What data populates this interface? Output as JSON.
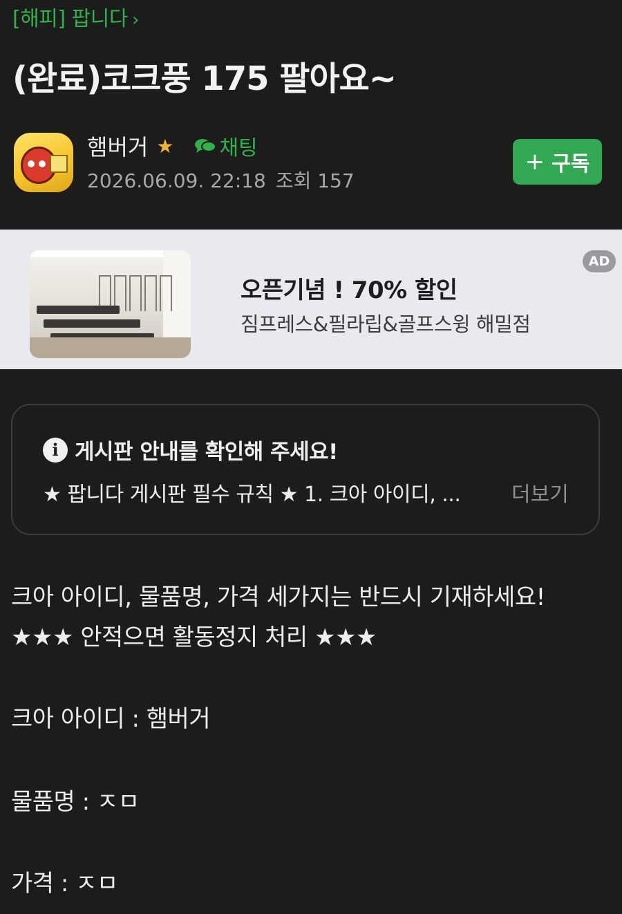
{
  "board": {
    "link_text": "[해피] 팝니다",
    "chevron": "›"
  },
  "post": {
    "title": "(완료)코크풍 175 팔아요~"
  },
  "author": {
    "nickname": "햄버거",
    "badge": "★",
    "chat_label": "채팅",
    "date": "2026.06.09. 22:18",
    "views": "조회 157"
  },
  "subscribe": {
    "icon": "+",
    "label": "구독"
  },
  "ad": {
    "title": "오픈기념 ! 70% 할인",
    "subtitle": "짐프레스&필라립&골프스윙 해밀점",
    "badge": "AD"
  },
  "notice": {
    "icon": "i",
    "heading": "게시판 안내를 확인해 주세요!",
    "preview": "★ 팝니다 게시판 필수 규칙 ★ 1. 크아 아이디, ...",
    "more": "더보기"
  },
  "body": {
    "lines": [
      "크아 아이디, 물품명, 가격 세가지는 반드시 기재하세요!",
      "★★★ 안적으면 활동정지 처리 ★★★",
      "크아 아이디 :  햄버거",
      "물품명 : ㅈㅁ",
      "가격 : ㅈㅁ"
    ]
  },
  "colors": {
    "accent": "#2fb24c",
    "button": "#33a853",
    "background": "#1c1c1c",
    "ad_bg": "#e9eaef"
  },
  "icons": [
    "chevron-right-icon",
    "star-icon",
    "chat-bubble-icon",
    "plus-icon",
    "info-icon"
  ]
}
